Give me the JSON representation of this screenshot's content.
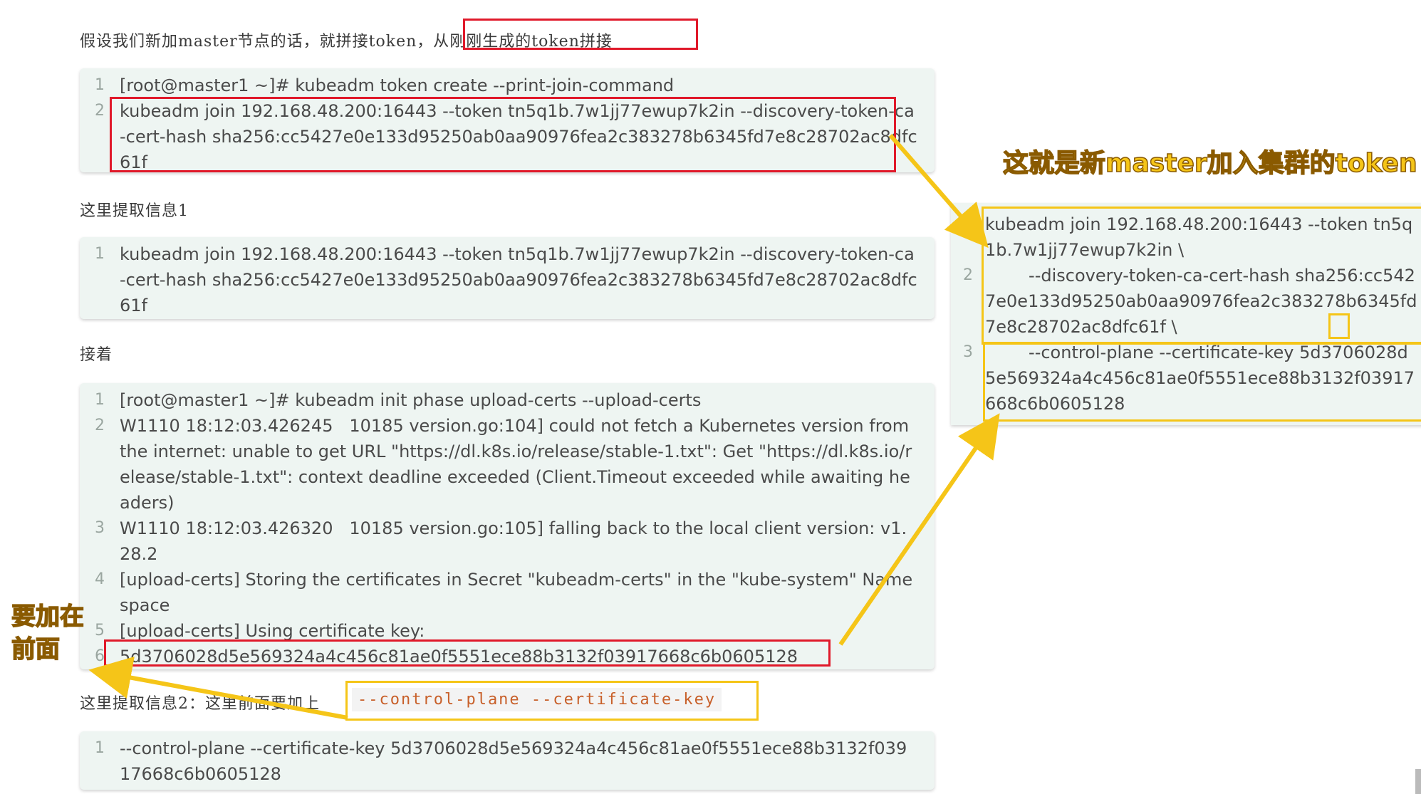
{
  "intro": {
    "prefix": "假设我们新加master节点的话，就拼接token，",
    "highlight": "从刚刚生成的token拼接"
  },
  "block1": {
    "lines": [
      {
        "n": "1",
        "text": "[root@master1 ~]# kubeadm token create --print-join-command"
      },
      {
        "n": "2",
        "text": "kubeadm join 192.168.48.200:16443 --token tn5q1b.7w1jj77ewup7k2in --discovery-token-ca-cert-hash sha256:cc5427e0e133d95250ab0aa90976fea2c383278b6345fd7e8c28702ac8dfc61f"
      }
    ]
  },
  "para_info1": "这里提取信息1",
  "block2": {
    "lines": [
      {
        "n": "1",
        "text": "kubeadm join 192.168.48.200:16443 --token tn5q1b.7w1jj77ewup7k2in --discovery-token-ca-cert-hash sha256:cc5427e0e133d95250ab0aa90976fea2c383278b6345fd7e8c28702ac8dfc61f"
      }
    ]
  },
  "para_next": "接着",
  "block3": {
    "lines": [
      {
        "n": "1",
        "text": "[root@master1 ~]# kubeadm init phase upload-certs --upload-certs"
      },
      {
        "n": "2",
        "text": "W1110 18:12:03.426245   10185 version.go:104] could not fetch a Kubernetes version from the internet: unable to get URL \"https://dl.k8s.io/release/stable-1.txt\": Get \"https://dl.k8s.io/release/stable-1.txt\": context deadline exceeded (Client.Timeout exceeded while awaiting headers)"
      },
      {
        "n": "3",
        "text": "W1110 18:12:03.426320   10185 version.go:105] falling back to the local client version: v1.28.2"
      },
      {
        "n": "4",
        "text": "[upload-certs] Storing the certificates in Secret \"kubeadm-certs\" in the \"kube-system\" Namespace"
      },
      {
        "n": "5",
        "text": "[upload-certs] Using certificate key:"
      },
      {
        "n": "6",
        "text": "5d3706028d5e569324a4c456c81ae0f5551ece88b3132f03917668c6b0605128"
      }
    ]
  },
  "para_info2": {
    "prefix": "这里提取信息2：这里前面要加上",
    "code": "--control-plane --certificate-key"
  },
  "block4": {
    "lines": [
      {
        "n": "1",
        "text": "--control-plane --certificate-key 5d3706028d5e569324a4c456c81ae0f5551ece88b3132f03917668c6b0605128"
      }
    ]
  },
  "annotation_right": "这就是新master加入集群的token",
  "annotation_left_1": "要加在",
  "annotation_left_2": "前面",
  "right_block": {
    "lines": [
      {
        "n": "1",
        "text": "kubeadm join 192.168.48.200:16443 --token tn5q1b.7w1jj77ewup7k2in \\"
      },
      {
        "n": "2",
        "text": "        --discovery-token-ca-cert-hash sha256:cc5427e0e133d95250ab0aa90976fea2c383278b6345fd7e8c28702ac8dfc61f \\"
      },
      {
        "n": "3",
        "text": "        --control-plane --certificate-key 5d3706028d5e569324a4c456c81ae0f5551ece88b3132f03917668c6b0605128"
      }
    ]
  },
  "colors": {
    "red_highlight": "#e0192a",
    "yellow_highlight": "#f5c518",
    "code_bg": "#eef5f2",
    "inline_code": "#c8602a"
  }
}
